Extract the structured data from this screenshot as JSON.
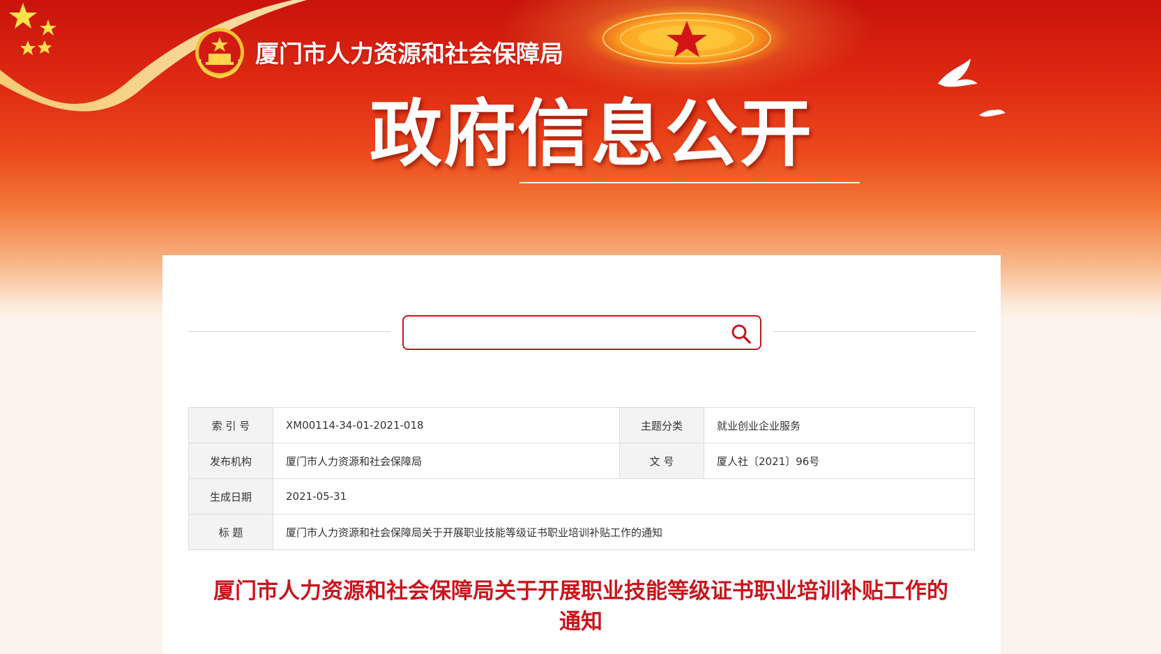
{
  "header": {
    "site_name": "厦门市人力资源和社会保障局",
    "banner_title": "政府信息公开",
    "emblem": "national-emblem",
    "decorations": [
      "star-icon",
      "dove-icon",
      "ribbon"
    ]
  },
  "search": {
    "placeholder": "",
    "value": "",
    "button_icon": "search-icon"
  },
  "meta": {
    "index_label": "索 引 号",
    "index_value": "XM00114-34-01-2021-018",
    "topic_label": "主题分类",
    "topic_value": "就业创业企业服务",
    "publisher_label": "发布机构",
    "publisher_value": "厦门市人力资源和社会保障局",
    "doc_no_label": "文 号",
    "doc_no_value": "厦人社〔2021〕96号",
    "date_label": "生成日期",
    "date_value": "2021-05-31",
    "title_label": "标 题",
    "title_value": "厦门市人力资源和社会保障局关于开展职业技能等级证书职业培训补贴工作的通知"
  },
  "document": {
    "title": "厦门市人力资源和社会保障局关于开展职业技能等级证书职业培训补贴工作的通知"
  },
  "colors": {
    "brand_red": "#c8161d",
    "banner_red": "#d91f12",
    "white": "#ffffff"
  }
}
